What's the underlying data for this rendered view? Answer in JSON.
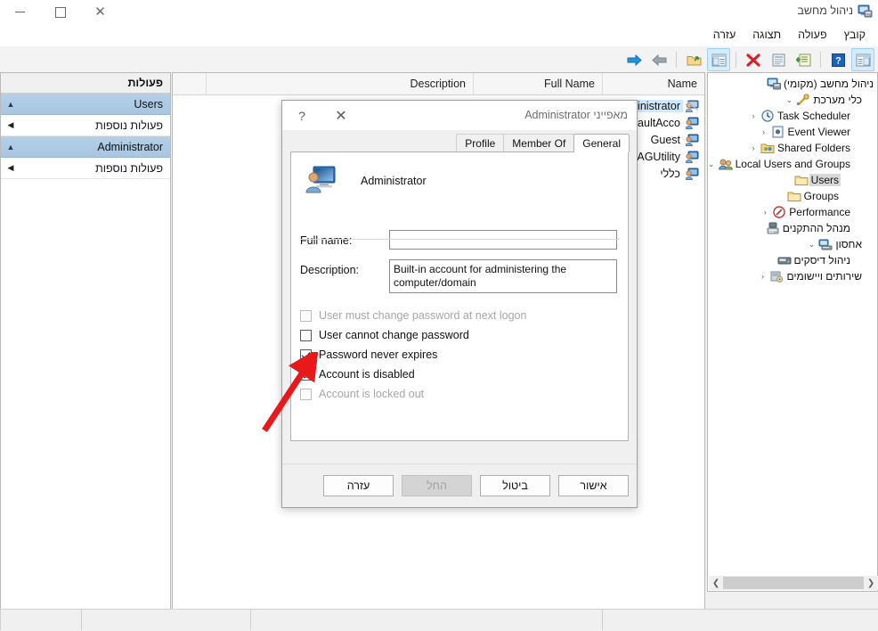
{
  "window": {
    "title": "ניהול מחשב",
    "icon": "computer-management-icon",
    "controls": {
      "close": "✕",
      "maximize": "□",
      "minimize": "—"
    }
  },
  "menubar": {
    "items": [
      {
        "label": "קובץ",
        "name": "menu-file"
      },
      {
        "label": "פעולה",
        "name": "menu-action"
      },
      {
        "label": "תצוגה",
        "name": "menu-view"
      },
      {
        "label": "עזרה",
        "name": "menu-help"
      }
    ]
  },
  "toolbar": {
    "buttons": [
      {
        "name": "show-hide-console-tree-button",
        "icon": "console-tree-icon",
        "active": true
      },
      {
        "name": "help-button",
        "icon": "question-mark-icon",
        "active": false
      },
      {
        "name": "properties-button",
        "icon": "properties-icon",
        "active": false
      },
      {
        "name": "refresh-button",
        "icon": "refresh-icon",
        "active": false
      },
      {
        "name": "delete-button",
        "icon": "red-x-icon",
        "active": false
      },
      {
        "name": "show-action-pane-button",
        "icon": "action-pane-icon",
        "active": true
      },
      {
        "name": "export-list-button",
        "icon": "export-folder-icon",
        "active": false
      },
      {
        "name": "back-button",
        "icon": "left-arrow-icon",
        "active": false
      },
      {
        "name": "forward-button",
        "icon": "right-arrow-icon",
        "active": false
      }
    ]
  },
  "tree": {
    "nodes": [
      {
        "label": "ניהול מחשב (מקומי)",
        "icon": "computer-icon",
        "twist": "",
        "indent": 0,
        "selected": false,
        "name": "tree-node-computer-management"
      },
      {
        "label": "כלי מערכת",
        "icon": "system-tools-icon",
        "twist": "⌄",
        "indent": 1,
        "selected": false,
        "name": "tree-node-system-tools"
      },
      {
        "label": "Task Scheduler",
        "icon": "clock-icon",
        "twist": "‹",
        "indent": 2,
        "selected": false,
        "name": "tree-node-task-scheduler"
      },
      {
        "label": "Event Viewer",
        "icon": "event-viewer-icon",
        "twist": "‹",
        "indent": 2,
        "selected": false,
        "name": "tree-node-event-viewer"
      },
      {
        "label": "Shared Folders",
        "icon": "shared-folders-icon",
        "twist": "‹",
        "indent": 2,
        "selected": false,
        "name": "tree-node-shared-folders"
      },
      {
        "label": "Local Users and Groups",
        "icon": "users-groups-icon",
        "twist": "⌄",
        "indent": 2,
        "selected": false,
        "name": "tree-node-local-users-and-groups"
      },
      {
        "label": "Users",
        "icon": "folder-icon",
        "twist": "",
        "indent": 3,
        "selected": true,
        "name": "tree-node-users"
      },
      {
        "label": "Groups",
        "icon": "folder-icon",
        "twist": "",
        "indent": 3,
        "selected": false,
        "name": "tree-node-groups"
      },
      {
        "label": "Performance",
        "icon": "performance-icon",
        "twist": "‹",
        "indent": 2,
        "selected": false,
        "name": "tree-node-performance"
      },
      {
        "label": "מנהל ההתקנים",
        "icon": "device-manager-icon",
        "twist": "",
        "indent": 2,
        "selected": false,
        "name": "tree-node-device-manager"
      },
      {
        "label": "אחסון",
        "icon": "storage-icon",
        "twist": "⌄",
        "indent": 1,
        "selected": false,
        "name": "tree-node-storage"
      },
      {
        "label": "ניהול דיסקים",
        "icon": "disk-management-icon",
        "twist": "",
        "indent": 2,
        "selected": false,
        "name": "tree-node-disk-management"
      },
      {
        "label": "שירותים ויישומים",
        "icon": "services-applications-icon",
        "twist": "‹",
        "indent": 1,
        "selected": false,
        "name": "tree-node-services-and-applications"
      }
    ]
  },
  "list": {
    "columns": [
      {
        "label": "Name",
        "name": "column-header-name"
      },
      {
        "label": "Full Name",
        "name": "column-header-full-name"
      },
      {
        "label": "Description",
        "name": "column-header-description"
      }
    ],
    "rows": [
      {
        "name_text": "Administrator",
        "icon": "user-disabled-icon",
        "selected": true
      },
      {
        "name_text": "DefaultAcco",
        "icon": "user-icon",
        "selected": false
      },
      {
        "name_text": "Guest",
        "icon": "user-icon",
        "selected": false
      },
      {
        "name_text": "DAGUtility",
        "icon": "user-icon",
        "selected": false
      },
      {
        "name_text": "כללי",
        "icon": "user-icon",
        "selected": false
      }
    ]
  },
  "actions_pane": {
    "title": "פעולות",
    "groups": [
      {
        "label": "Users",
        "chev": "▲",
        "name": "actions-group-users"
      },
      {
        "label": "פעולות נוספות",
        "chev": "◀",
        "name": "actions-more-users"
      },
      {
        "label": "Administrator",
        "chev": "▲",
        "name": "actions-group-administrator"
      },
      {
        "label": "פעולות נוספות",
        "chev": "◀",
        "name": "actions-more-administrator"
      }
    ]
  },
  "dialog": {
    "title": "מאפייני Administrator",
    "help_glyph": "?",
    "close_glyph": "✕",
    "tabs": [
      {
        "label": "General",
        "active": true,
        "name": "tab-general"
      },
      {
        "label": "Member Of",
        "active": false,
        "name": "tab-member-of"
      },
      {
        "label": "Profile",
        "active": false,
        "name": "tab-profile"
      }
    ],
    "account_name": "Administrator",
    "fields": [
      {
        "label": "Full name:",
        "value": "",
        "placeholder": "",
        "name": "full-name-field",
        "lines": 1
      },
      {
        "label": "Description:",
        "value": "Built-in account for administering the computer/domain",
        "placeholder": "",
        "name": "description-field",
        "lines": 2
      }
    ],
    "checkboxes": [
      {
        "label": "User must change password at next logon",
        "checked": false,
        "disabled": true,
        "name": "checkbox-user-must-change-password"
      },
      {
        "label": "User cannot change password",
        "checked": false,
        "disabled": false,
        "name": "checkbox-user-cannot-change-password"
      },
      {
        "label": "Password never expires",
        "checked": true,
        "disabled": false,
        "name": "checkbox-password-never-expires"
      },
      {
        "label": "Account is disabled",
        "checked": true,
        "disabled": false,
        "name": "checkbox-account-is-disabled"
      },
      {
        "label": "Account is locked out",
        "checked": false,
        "disabled": true,
        "name": "checkbox-account-is-locked-out"
      }
    ],
    "buttons": [
      {
        "label": "אישור",
        "disabled": false,
        "name": "ok-button"
      },
      {
        "label": "ביטול",
        "disabled": false,
        "name": "cancel-button"
      },
      {
        "label": "החל",
        "disabled": true,
        "name": "apply-button"
      },
      {
        "label": "עזרה",
        "disabled": false,
        "name": "help-button"
      }
    ]
  },
  "annotation": {
    "color": "#e8191b",
    "name": "annotation-arrow"
  },
  "colors": {
    "selection_blue": "#cde8ff",
    "group_header_blue": "#b5cfe7",
    "toolbar_active": "#d6ebfb",
    "annotation_red": "#e8191b"
  }
}
